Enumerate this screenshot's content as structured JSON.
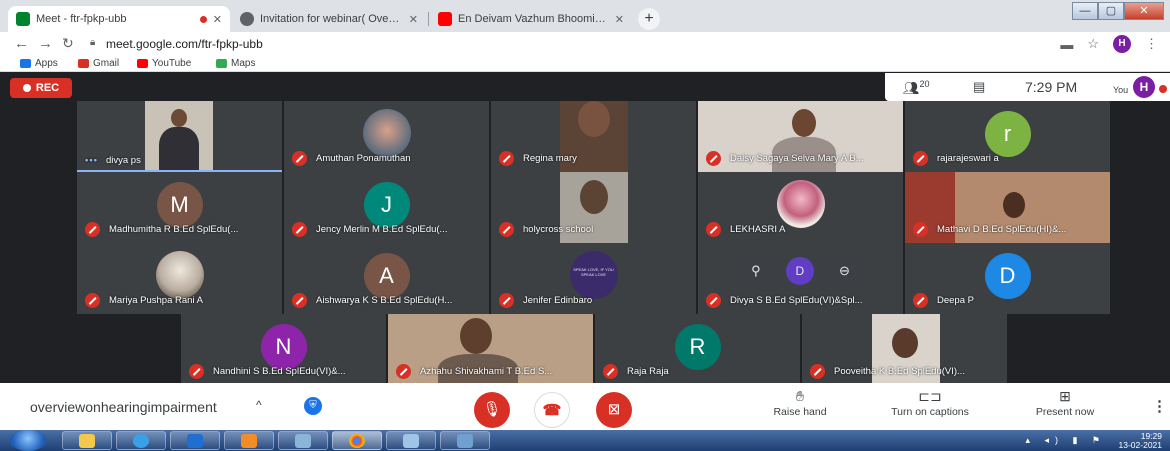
{
  "browser": {
    "tabs": [
      {
        "title": "Meet - ftr-fpkp-ubb",
        "fav_color": "#00832d"
      },
      {
        "title": "Invitation for webinar( Overview",
        "fav_color": "#5f6368"
      },
      {
        "title": "En Deivam Vazhum Bhoomi ithu",
        "fav_color": "#ff0000"
      }
    ],
    "new_tab": "+",
    "window_buttons": [
      "—",
      "▢",
      "✕"
    ],
    "url": "meet.google.com/ftr-fpkp-ubb",
    "profile_initial": "H",
    "bookmarks": [
      {
        "label": "Apps",
        "color": "#1a73e8"
      },
      {
        "label": "Gmail",
        "color": "#d93025"
      },
      {
        "label": "YouTube",
        "color": "#ff0000"
      },
      {
        "label": "Maps",
        "color": "#34a853"
      }
    ]
  },
  "meet": {
    "rec_label": "REC",
    "participants_count": "20",
    "time": "7:29 PM",
    "you_label": "You",
    "you_initial": "H",
    "tiles": [
      {
        "name": "divya ps",
        "kind": "video",
        "speaking": true
      },
      {
        "name": "Amuthan Ponamuthan",
        "kind": "photo",
        "photo_color": "#c97f6b"
      },
      {
        "name": "Regina mary",
        "kind": "video"
      },
      {
        "name": "Daisy Sagaya Selva Mary A B...",
        "kind": "video"
      },
      {
        "name": "rajarajeswari a",
        "kind": "initial",
        "initial": "r",
        "color": "#7cb342"
      },
      {
        "name": "Madhumitha R B.Ed SplEdu(...",
        "kind": "initial",
        "initial": "M",
        "color": "#795548"
      },
      {
        "name": "Jency Merlin M B.Ed SplEdu(...",
        "kind": "initial",
        "initial": "J",
        "color": "#00897b"
      },
      {
        "name": "holycross school",
        "kind": "video"
      },
      {
        "name": "LEKHASRI A",
        "kind": "photo",
        "photo_color": "#e8a3b6"
      },
      {
        "name": "Mathavi D B.Ed SplEdu(HI)&...",
        "kind": "video"
      },
      {
        "name": "Mariya Pushpa Rani A",
        "kind": "photo",
        "photo_color": "#b8b0a6"
      },
      {
        "name": "Aishwarya K S B.Ed SplEdu(H...",
        "kind": "initial",
        "initial": "A",
        "color": "#795548"
      },
      {
        "name": "Jenifer Edinbaro",
        "kind": "photo",
        "photo_color": "#3b2b6b",
        "photo_text": "SPEAK LOVE, IF YOU SPEAK LOVE"
      },
      {
        "name": "Divya S B.Ed SplEdu(VI)&Spl...",
        "kind": "hover",
        "initial": "D"
      },
      {
        "name": "Deepa P",
        "kind": "initial",
        "initial": "D",
        "color": "#1e88e5"
      },
      {
        "name": "Nandhini S B.Ed SplEdu(VI)&...",
        "kind": "initial",
        "initial": "N",
        "color": "#8e24aa"
      },
      {
        "name": "Azhahu Shivakhami T B.Ed S...",
        "kind": "video"
      },
      {
        "name": "Raja Raja",
        "kind": "initial",
        "initial": "R",
        "color": "#00796b"
      },
      {
        "name": "Pooveitha K B.Ed SplEdu(VI)...",
        "kind": "video"
      }
    ]
  },
  "controls": {
    "meeting_name": "overviewonhearingimpairment",
    "raise_hand": "Raise hand",
    "captions": "Turn on captions",
    "present": "Present now"
  },
  "taskbar": {
    "time": "19:29",
    "date": "13-02-2021"
  }
}
